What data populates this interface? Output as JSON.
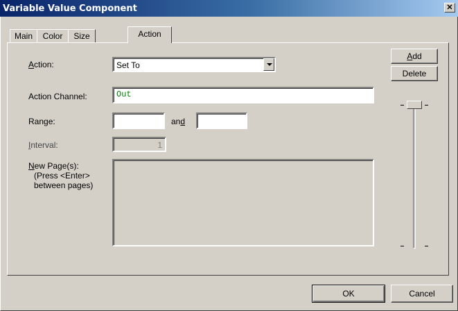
{
  "window": {
    "title": "Variable Value Component",
    "close_glyph": "✕"
  },
  "tabs": [
    {
      "label": "Main"
    },
    {
      "label": "Color"
    },
    {
      "label": "Size"
    },
    {
      "label": "Action"
    }
  ],
  "form": {
    "action_label": "Action:",
    "action_value": "Set To",
    "channel_label": "Action Channel:",
    "channel_value": "Out",
    "range_label": "Range:",
    "range_from": "",
    "range_and": "and",
    "range_to": "",
    "interval_label": "Interval:",
    "interval_value": "1",
    "new_pages_label": "New Page(s):",
    "new_pages_hint1": "(Press <Enter>",
    "new_pages_hint2": "between pages)",
    "new_pages_value": ""
  },
  "side_buttons": {
    "add": "Add",
    "delete": "Delete"
  },
  "footer": {
    "ok": "OK",
    "cancel": "Cancel"
  },
  "colors": {
    "title_start": "#0a246a",
    "title_end": "#a6caf0",
    "channel_text": "#008000"
  }
}
